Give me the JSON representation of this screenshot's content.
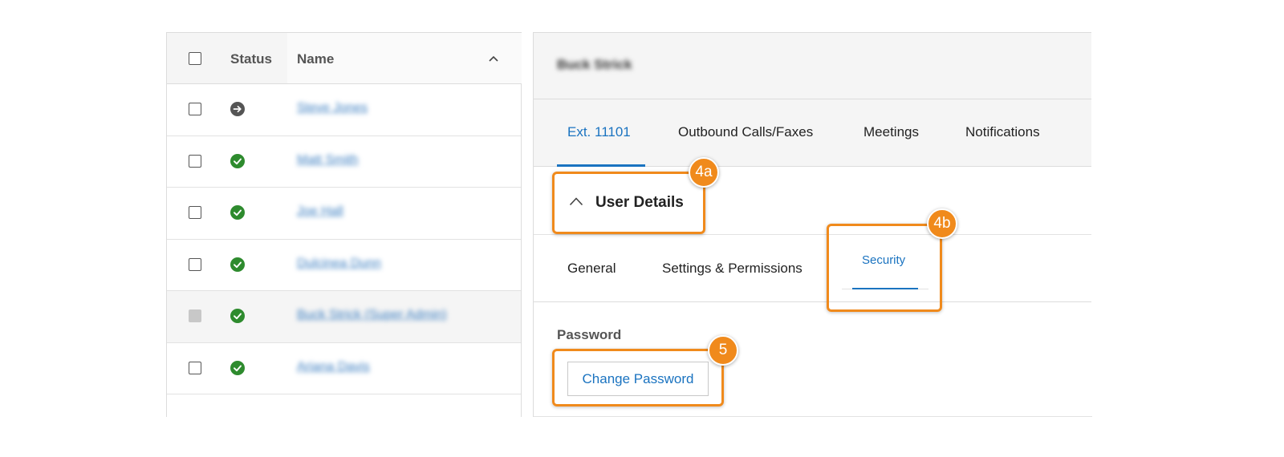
{
  "user_list": {
    "columns": {
      "status": "Status",
      "name": "Name"
    },
    "sort_icon": "chevron-up-icon",
    "rows": [
      {
        "status": "forwarding",
        "status_icon": "arrow-right-circle-icon",
        "name": "Steve Jones",
        "selected": false
      },
      {
        "status": "active",
        "status_icon": "check-circle-icon",
        "name": "Matt Smith",
        "selected": false
      },
      {
        "status": "active",
        "status_icon": "check-circle-icon",
        "name": "Joe Hall",
        "selected": false
      },
      {
        "status": "active",
        "status_icon": "check-circle-icon",
        "name": "Dulcinea Dunn",
        "selected": false
      },
      {
        "status": "active",
        "status_icon": "check-circle-icon",
        "name": "Buck Strick (Super Admin)",
        "selected": false,
        "disabled": true
      },
      {
        "status": "active",
        "status_icon": "check-circle-icon",
        "name": "Ariana Davis",
        "selected": false
      }
    ]
  },
  "detail": {
    "title": "Buck Strick",
    "tabs": [
      {
        "label": "Ext. 11101",
        "active": true
      },
      {
        "label": "Outbound Calls/Faxes",
        "active": false
      },
      {
        "label": "Meetings",
        "active": false
      },
      {
        "label": "Notifications",
        "active": false
      }
    ],
    "section": {
      "title": "User Details",
      "icon": "chevron-up-icon"
    },
    "subtabs": [
      {
        "label": "General",
        "active": false
      },
      {
        "label": "Settings & Permissions",
        "active": false
      },
      {
        "label": "Security",
        "active": true
      }
    ],
    "password": {
      "label": "Password",
      "button": "Change Password"
    }
  },
  "callouts": [
    {
      "label": "4a"
    },
    {
      "label": "4b"
    },
    {
      "label": "5"
    }
  ],
  "colors": {
    "accent": "#1a73c0",
    "callout": "#f08a1c",
    "status_active": "#2e8b2e",
    "status_forwarding": "#555555"
  }
}
